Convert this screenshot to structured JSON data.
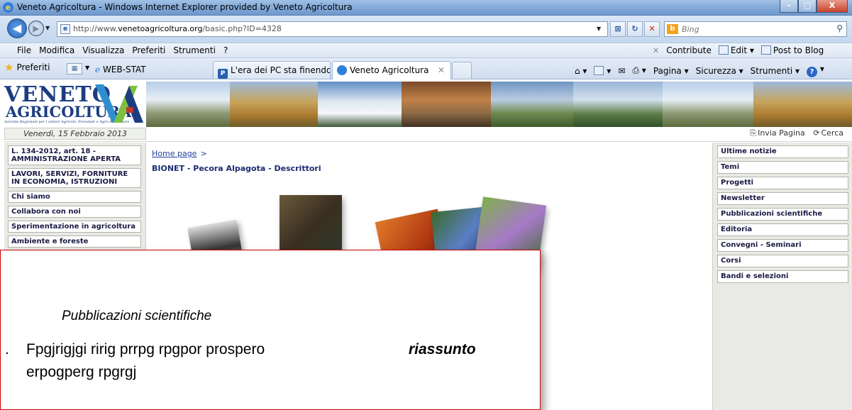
{
  "window": {
    "title": "Veneto Agricoltura - Windows Internet Explorer provided by Veneto Agricoltura",
    "minimize": "–",
    "maximize": "□",
    "close": "X"
  },
  "address": {
    "url_prefix": "http://www.",
    "url_domain": "venetoagricoltura.org",
    "url_path": "/basic.php?ID=4328",
    "search_placeholder": "Bing"
  },
  "menubar": {
    "items": [
      "File",
      "Modifica",
      "Visualizza",
      "Preferiti",
      "Strumenti",
      "?"
    ],
    "contribute": "Contribute",
    "edit": "Edit",
    "post": "Post to Blog"
  },
  "tabsbar": {
    "favorites": "Preferiti",
    "webstat": "WEB-STAT",
    "tabs": [
      {
        "label": "L'era dei PC sta finendo?Si..."
      },
      {
        "label": "Veneto Agricoltura"
      }
    ],
    "commands": {
      "pagina": "Pagina",
      "sicurezza": "Sicurezza",
      "strumenti": "Strumenti"
    }
  },
  "site": {
    "logo_line1": "VENETO",
    "logo_line2": "AGRICOLTURA",
    "logo_tagline": "Azienda Regionale per i settori Agricolo, Forestale e Agro-Alimentare",
    "date": "Venerdì, 15 Febbraio 2013",
    "send_page": "Invia Pagina",
    "search": "Cerca"
  },
  "left_nav": [
    "L. 134-2012, art. 18 - AMMINISTRAZIONE APERTA",
    "LAVORI, SERVIZI, FORNITURE IN ECONOMIA, ISTRUZIONI",
    "Chi siamo",
    "Collabora con noi",
    "Sperimentazione in agricoltura",
    "Ambiente e foreste"
  ],
  "content": {
    "breadcrumb_home": "Home page",
    "breadcrumb_sep": ">",
    "title": "BIONET - Pecora Alpagota - Descrittori"
  },
  "right_nav": [
    "Ultime notizie",
    "Temi",
    "Progetti",
    "Newsletter",
    "Pubblicazioni scientifiche",
    "Editoria",
    "Convegni - Seminari",
    "Corsi",
    "Bandi e selezioni"
  ],
  "overlay": {
    "heading": "Pubblicazioni scientifiche",
    "number": ".",
    "line1": "Fpgjrigjgi ririg prrpg rpgpor prospero",
    "tag": "riassunto",
    "line2": "erpogperg rpgrgj"
  }
}
